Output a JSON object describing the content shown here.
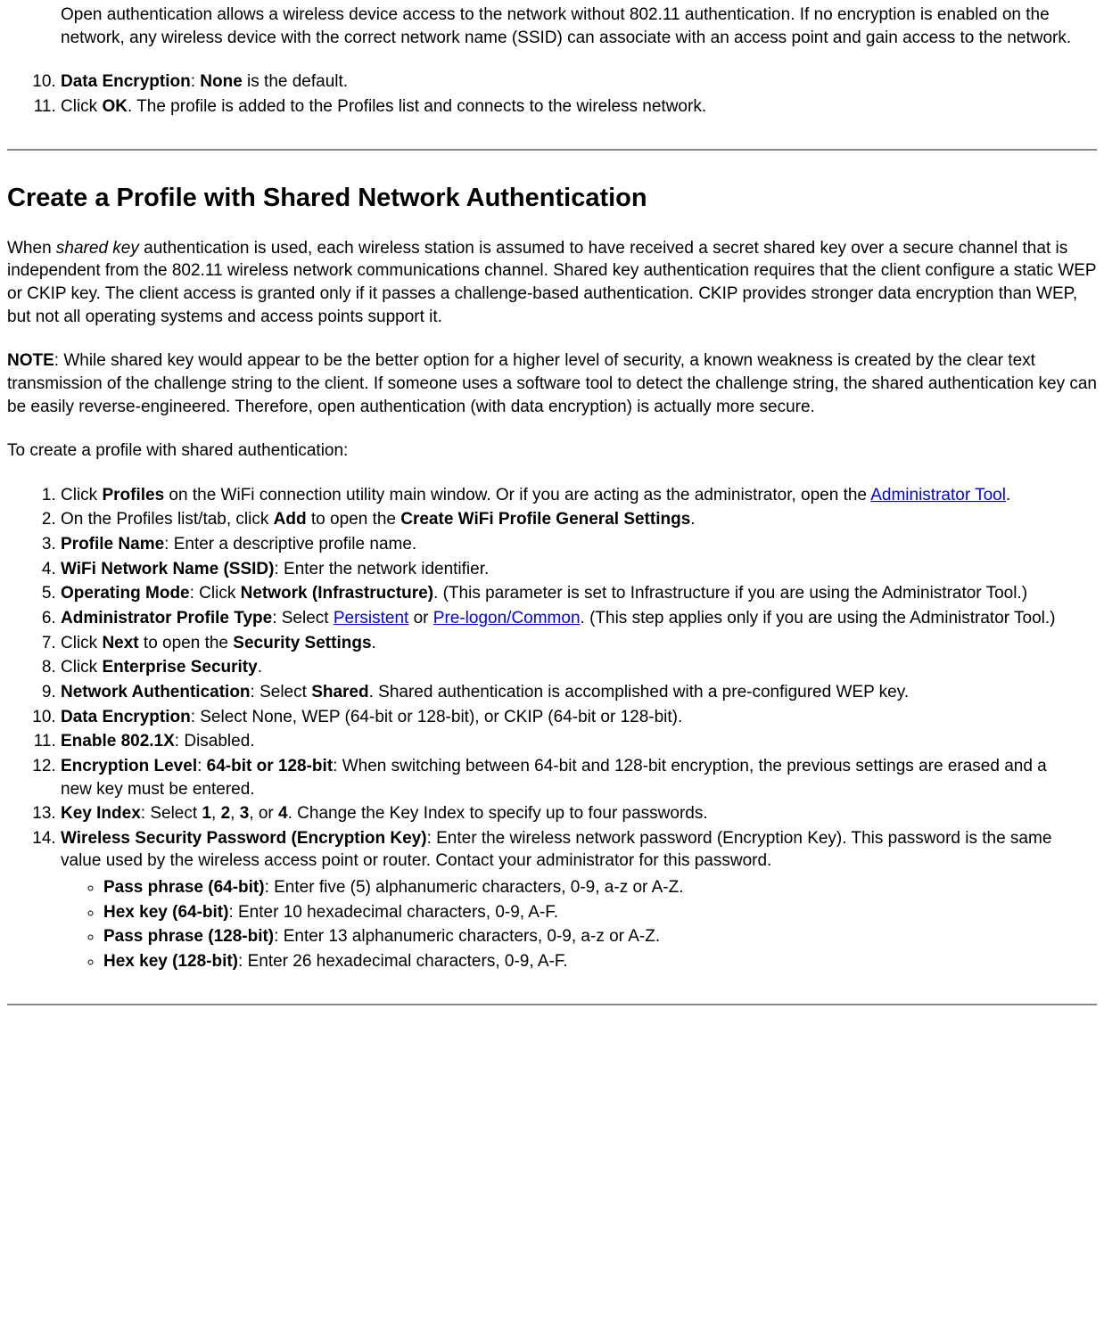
{
  "intro_paragraph": "Open authentication allows a wireless device access to the network without 802.11 authentication. If no encryption is enabled on the network, any wireless device with the correct network name (SSID) can associate with an access point and gain access to the network.",
  "top_list": {
    "item10": {
      "label": "Data Encryption",
      "value_bold": "None",
      "tail": " is the default."
    },
    "item11": {
      "pre": "Click ",
      "bold": "OK",
      "post": ". The profile is added to the Profiles list and connects to the wireless network."
    }
  },
  "heading": "Create a Profile with Shared Network Authentication",
  "para1": {
    "pre": "When ",
    "italic": "shared key",
    "post": " authentication is used, each wireless station is assumed to have received a secret shared key over a secure channel that is independent from the 802.11 wireless network communications channel. Shared key authentication requires that the client configure a static WEP or CKIP key. The client access is granted only if it passes a challenge-based authentication. CKIP provides stronger data encryption than WEP, but not all operating systems and access points support it."
  },
  "para2": {
    "bold": "NOTE",
    "post": ": While shared key would appear to be the better option for a higher level of security, a known weakness is created by the clear text transmission of the challenge string to the client. If someone uses a software tool to detect the challenge string, the shared authentication key can be easily reverse-engineered. Therefore, open authentication (with data encryption) is actually more secure."
  },
  "para3": "To create a profile with shared authentication:",
  "steps": {
    "s1": {
      "pre": "Click ",
      "b1": "Profiles",
      "mid": " on the WiFi connection utility main window. Or if you are acting as the administrator, open the ",
      "link": "Administrator Tool",
      "post": "."
    },
    "s2": {
      "pre": "On the Profiles list/tab, click ",
      "b1": "Add",
      "mid": " to open the ",
      "b2": "Create WiFi Profile General Settings",
      "post": "."
    },
    "s3": {
      "b1": "Profile Name",
      "post": ": Enter a descriptive profile name."
    },
    "s4": {
      "b1": "WiFi Network Name (SSID)",
      "post": ": Enter the network identifier."
    },
    "s5": {
      "b1": "Operating Mode",
      "mid": ": Click ",
      "b2": "Network (Infrastructure)",
      "post": ". (This parameter is set to Infrastructure if you are using the Administrator Tool.)"
    },
    "s6": {
      "b1": "Administrator Profile Type",
      "mid": ": Select ",
      "link1": "Persistent",
      "mid2": " or ",
      "link2": "Pre-logon/Common",
      "post": ". (This step applies only if you are using the Administrator Tool.)"
    },
    "s7": {
      "pre": "Click ",
      "b1": "Next",
      "mid": " to open the ",
      "b2": "Security Settings",
      "post": "."
    },
    "s8": {
      "pre": "Click ",
      "b1": "Enterprise Security",
      "post": "."
    },
    "s9": {
      "b1": "Network Authentication",
      "mid": ": Select ",
      "b2": "Shared",
      "post": ". Shared authentication is accomplished with a pre-configured WEP key."
    },
    "s10": {
      "b1": "Data Encryption",
      "post": ": Select None, WEP (64-bit or 128-bit), or CKIP (64-bit or 128-bit)."
    },
    "s11": {
      "b1": "Enable 802.1X",
      "post": ": Disabled."
    },
    "s12": {
      "b1": "Encryption Level",
      "mid": ": ",
      "b2": "64-bit or 128-bit",
      "post": ": When switching between 64-bit and 128-bit encryption, the previous settings are erased and a new key must be entered."
    },
    "s13": {
      "b1": "Key Index",
      "mid": ": Select ",
      "b2": "1",
      "c1": ", ",
      "b3": "2",
      "c2": ", ",
      "b4": "3",
      "c3": ", or ",
      "b5": "4",
      "post": ". Change the Key Index to specify up to four passwords."
    },
    "s14": {
      "b1": "Wireless Security Password (Encryption Key)",
      "post": ": Enter the wireless network password (Encryption Key). This password is the same value used by the wireless access point or router. Contact your administrator for this password.",
      "sub": {
        "a": {
          "b": "Pass phrase (64-bit)",
          "t": ": Enter five (5) alphanumeric characters, 0-9, a-z or A-Z."
        },
        "b": {
          "b": "Hex key (64-bit)",
          "t": ": Enter 10 hexadecimal characters, 0-9, A-F."
        },
        "c": {
          "b": "Pass phrase (128-bit)",
          "t": ": Enter 13 alphanumeric characters, 0-9, a-z or A-Z."
        },
        "d": {
          "b": "Hex key (128-bit)",
          "t": ": Enter 26 hexadecimal characters, 0-9, A-F."
        }
      }
    }
  }
}
